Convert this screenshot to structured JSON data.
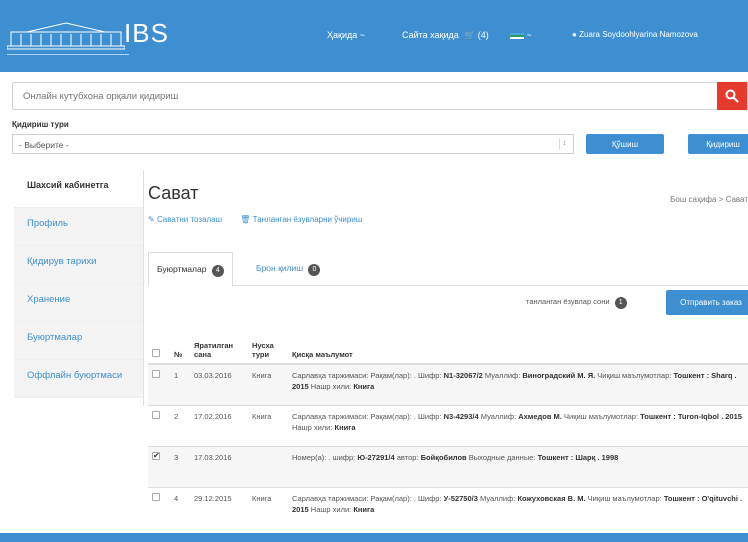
{
  "header": {
    "logo_text": "IBS",
    "nav": {
      "item1": "Ҳақида ~",
      "item2": "Сайта хақида",
      "cart": "(4)",
      "lang": "~",
      "user": "Zuara Soydoohlyarina Namozova"
    }
  },
  "search": {
    "placeholder": "Онлайн кутубхона орқали қидириш"
  },
  "search_type": {
    "label": "Қидириш тури",
    "selected": "- Выберите -",
    "btn_primary": "Қўшиш",
    "btn_secondary": "Қидириш"
  },
  "sidebar": {
    "items": [
      {
        "label": "Шахсий кабинетга"
      },
      {
        "label": "Профиль"
      },
      {
        "label": "Қидирув тарихи"
      },
      {
        "label": "Хранение"
      },
      {
        "label": "Буюртмалар"
      },
      {
        "label": "Оффлайн буюртмаси"
      }
    ]
  },
  "main": {
    "title": "Сават",
    "breadcrumb": "Бош саҳифа > Сават",
    "action_clear": "Саватни тозалаш",
    "action_delete": "Танланган ёзувларни ўчириш",
    "tabs": [
      {
        "label": "Буюртмалар",
        "count": "4"
      },
      {
        "label": "Брон қилиш",
        "count": "0"
      }
    ],
    "selected_count_label": "танланган ёзувлар сони",
    "selected_count": "1",
    "send_button": "Отправить заказ",
    "table": {
      "headers": {
        "no": "№",
        "date": "Яратилган сана",
        "type": "Нусха тури",
        "info": "Қисқа маълумот"
      },
      "rows": [
        {
          "no": "1",
          "date": "03.03.2016",
          "type": "Книга",
          "info_pre": "Сарлавҳа таржимаси: Рақам(лар): . Шифр:",
          "info_code": "N1-32067/2",
          "info_mid": "Муаллиф:",
          "info_author": "Виноградский М. Я.",
          "info_pub_label": "Чиқиш маълумотлар:",
          "info_pub": "Тошкент : Sharq . 2015",
          "info_kind_label": "Нашр хили:",
          "info_kind": "Книга",
          "checked": false
        },
        {
          "no": "2",
          "date": "17.02.2016",
          "type": "Книга",
          "info_pre": "Сарлавҳа таржимаси: Рақам(лар): . Шифр:",
          "info_code": "N3-4293/4",
          "info_mid": "Муаллиф:",
          "info_author": "Ахмедов М.",
          "info_pub_label": "Чиқиш маълумотлар:",
          "info_pub": "Тошкент : Turon-Iqbol . 2015",
          "info_kind_label": "Нашр хили:",
          "info_kind": "Книга",
          "checked": false
        },
        {
          "no": "3",
          "date": "17.03.2016",
          "type": "",
          "info_pre": "Номер(а): . шифр:",
          "info_code": "Ю-27291/4",
          "info_mid": "автор:",
          "info_author": "Бойқобилов",
          "info_pub_label": "Выходные данные:",
          "info_pub": "Тошкент : Шарқ . 1998",
          "info_kind_label": "",
          "info_kind": "",
          "checked": true
        },
        {
          "no": "4",
          "date": "29.12.2015",
          "type": "Книга",
          "info_pre": "Сарлавҳа таржимаси: Рақам(лар): . Шифр:",
          "info_code": "У-52750/3",
          "info_mid": "Муаллиф:",
          "info_author": "Кожуховская В. М.",
          "info_pub_label": "Чиқиш маълумотлар:",
          "info_pub": "Тошкент : O'qituvchi . 2015",
          "info_kind_label": "Нашр хили:",
          "info_kind": "Книга",
          "checked": false
        }
      ]
    }
  },
  "colors": {
    "primary": "#3d8fd1",
    "search_button": "#e53b2c"
  }
}
